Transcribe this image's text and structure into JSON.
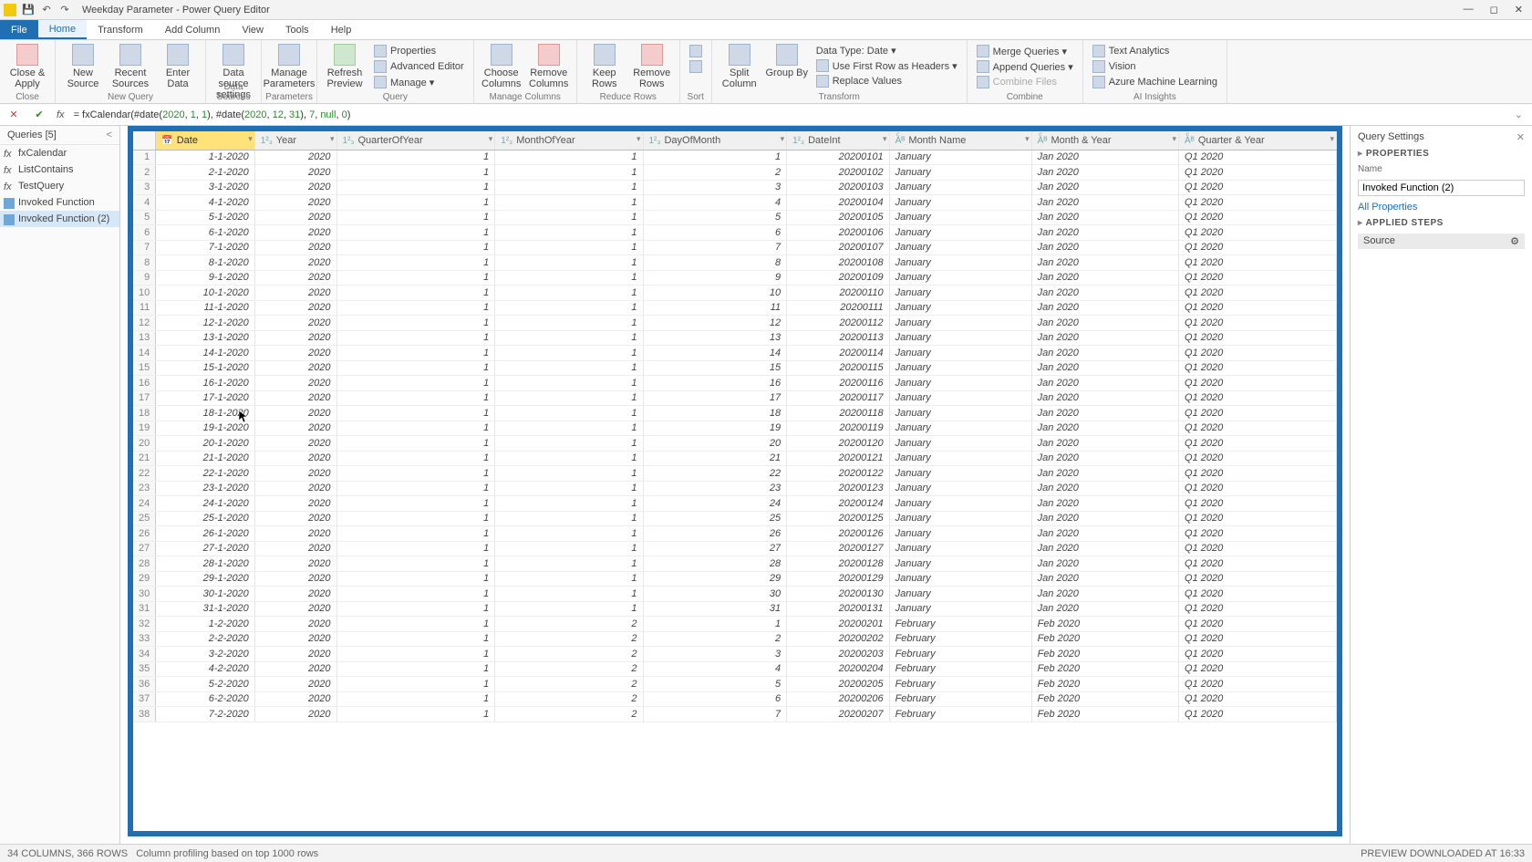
{
  "title": "Weekday Parameter - Power Query Editor",
  "tabs": [
    "File",
    "Home",
    "Transform",
    "Add Column",
    "View",
    "Tools",
    "Help"
  ],
  "activeTab": "Home",
  "ribbon": {
    "close": {
      "close_apply": "Close &\nApply",
      "group": "Close"
    },
    "newquery": {
      "new_source": "New\nSource",
      "recent": "Recent\nSources",
      "enter": "Enter\nData",
      "group": "New Query"
    },
    "datasources": {
      "ds": "Data source\nsettings",
      "group": "Data Sources"
    },
    "params": {
      "mp": "Manage\nParameters",
      "group": "Parameters"
    },
    "query": {
      "refresh": "Refresh\nPreview",
      "props": "Properties",
      "adv": "Advanced Editor",
      "manage": "Manage ▾",
      "group": "Query"
    },
    "managecols": {
      "choose": "Choose\nColumns",
      "remove": "Remove\nColumns",
      "group": "Manage Columns"
    },
    "reducerows": {
      "keep": "Keep\nRows",
      "removerows": "Remove\nRows",
      "group": "Reduce Rows"
    },
    "sort": {
      "group": "Sort"
    },
    "transform": {
      "split": "Split\nColumn",
      "group_by": "Group\nBy",
      "dtype": "Data Type: Date ▾",
      "firstrow": "Use First Row as Headers ▾",
      "replace": "Replace Values",
      "group": "Transform"
    },
    "combine": {
      "merge": "Merge Queries ▾",
      "append": "Append Queries ▾",
      "combinefiles": "Combine Files",
      "group": "Combine"
    },
    "ai": {
      "ta": "Text Analytics",
      "vision": "Vision",
      "aml": "Azure Machine Learning",
      "group": "AI Insights"
    }
  },
  "formula_prefix": "= fxCalendar(#date(",
  "formula_parts": {
    "a": "2020",
    "b": ", ",
    "c": "1",
    "d": ", ",
    "e": "1",
    "f": "), #date(",
    "g": "2020",
    "h": ", ",
    "i": "12",
    "j": ", ",
    "k": "31",
    "l": "), ",
    "m": "7",
    "n": ", ",
    "o": "null",
    "p": ", ",
    "q": "0",
    "r": ")"
  },
  "queries_hdr": "Queries [5]",
  "queries": [
    {
      "name": "fxCalendar",
      "type": "fx"
    },
    {
      "name": "ListContains",
      "type": "fx"
    },
    {
      "name": "TestQuery",
      "type": "fx"
    },
    {
      "name": "Invoked Function",
      "type": "tbl"
    },
    {
      "name": "Invoked Function (2)",
      "type": "tbl",
      "selected": true
    }
  ],
  "columns": [
    "Date",
    "Year",
    "QuarterOfYear",
    "MonthOfYear",
    "DayOfMonth",
    "DateInt",
    "Month Name",
    "Month & Year",
    "Quarter & Year"
  ],
  "col_types": [
    "📅",
    "1²₃",
    "1²₃",
    "1²₃",
    "1²₃",
    "1²₃",
    "Aͨᴮ",
    "Aͨᴮ",
    "Aͨᴮ"
  ],
  "rows": [
    [
      "1-1-2020",
      "2020",
      "1",
      "1",
      "1",
      "20200101",
      "January",
      "Jan 2020",
      "Q1 2020"
    ],
    [
      "2-1-2020",
      "2020",
      "1",
      "1",
      "2",
      "20200102",
      "January",
      "Jan 2020",
      "Q1 2020"
    ],
    [
      "3-1-2020",
      "2020",
      "1",
      "1",
      "3",
      "20200103",
      "January",
      "Jan 2020",
      "Q1 2020"
    ],
    [
      "4-1-2020",
      "2020",
      "1",
      "1",
      "4",
      "20200104",
      "January",
      "Jan 2020",
      "Q1 2020"
    ],
    [
      "5-1-2020",
      "2020",
      "1",
      "1",
      "5",
      "20200105",
      "January",
      "Jan 2020",
      "Q1 2020"
    ],
    [
      "6-1-2020",
      "2020",
      "1",
      "1",
      "6",
      "20200106",
      "January",
      "Jan 2020",
      "Q1 2020"
    ],
    [
      "7-1-2020",
      "2020",
      "1",
      "1",
      "7",
      "20200107",
      "January",
      "Jan 2020",
      "Q1 2020"
    ],
    [
      "8-1-2020",
      "2020",
      "1",
      "1",
      "8",
      "20200108",
      "January",
      "Jan 2020",
      "Q1 2020"
    ],
    [
      "9-1-2020",
      "2020",
      "1",
      "1",
      "9",
      "20200109",
      "January",
      "Jan 2020",
      "Q1 2020"
    ],
    [
      "10-1-2020",
      "2020",
      "1",
      "1",
      "10",
      "20200110",
      "January",
      "Jan 2020",
      "Q1 2020"
    ],
    [
      "11-1-2020",
      "2020",
      "1",
      "1",
      "11",
      "20200111",
      "January",
      "Jan 2020",
      "Q1 2020"
    ],
    [
      "12-1-2020",
      "2020",
      "1",
      "1",
      "12",
      "20200112",
      "January",
      "Jan 2020",
      "Q1 2020"
    ],
    [
      "13-1-2020",
      "2020",
      "1",
      "1",
      "13",
      "20200113",
      "January",
      "Jan 2020",
      "Q1 2020"
    ],
    [
      "14-1-2020",
      "2020",
      "1",
      "1",
      "14",
      "20200114",
      "January",
      "Jan 2020",
      "Q1 2020"
    ],
    [
      "15-1-2020",
      "2020",
      "1",
      "1",
      "15",
      "20200115",
      "January",
      "Jan 2020",
      "Q1 2020"
    ],
    [
      "16-1-2020",
      "2020",
      "1",
      "1",
      "16",
      "20200116",
      "January",
      "Jan 2020",
      "Q1 2020"
    ],
    [
      "17-1-2020",
      "2020",
      "1",
      "1",
      "17",
      "20200117",
      "January",
      "Jan 2020",
      "Q1 2020"
    ],
    [
      "18-1-2020",
      "2020",
      "1",
      "1",
      "18",
      "20200118",
      "January",
      "Jan 2020",
      "Q1 2020"
    ],
    [
      "19-1-2020",
      "2020",
      "1",
      "1",
      "19",
      "20200119",
      "January",
      "Jan 2020",
      "Q1 2020"
    ],
    [
      "20-1-2020",
      "2020",
      "1",
      "1",
      "20",
      "20200120",
      "January",
      "Jan 2020",
      "Q1 2020"
    ],
    [
      "21-1-2020",
      "2020",
      "1",
      "1",
      "21",
      "20200121",
      "January",
      "Jan 2020",
      "Q1 2020"
    ],
    [
      "22-1-2020",
      "2020",
      "1",
      "1",
      "22",
      "20200122",
      "January",
      "Jan 2020",
      "Q1 2020"
    ],
    [
      "23-1-2020",
      "2020",
      "1",
      "1",
      "23",
      "20200123",
      "January",
      "Jan 2020",
      "Q1 2020"
    ],
    [
      "24-1-2020",
      "2020",
      "1",
      "1",
      "24",
      "20200124",
      "January",
      "Jan 2020",
      "Q1 2020"
    ],
    [
      "25-1-2020",
      "2020",
      "1",
      "1",
      "25",
      "20200125",
      "January",
      "Jan 2020",
      "Q1 2020"
    ],
    [
      "26-1-2020",
      "2020",
      "1",
      "1",
      "26",
      "20200126",
      "January",
      "Jan 2020",
      "Q1 2020"
    ],
    [
      "27-1-2020",
      "2020",
      "1",
      "1",
      "27",
      "20200127",
      "January",
      "Jan 2020",
      "Q1 2020"
    ],
    [
      "28-1-2020",
      "2020",
      "1",
      "1",
      "28",
      "20200128",
      "January",
      "Jan 2020",
      "Q1 2020"
    ],
    [
      "29-1-2020",
      "2020",
      "1",
      "1",
      "29",
      "20200129",
      "January",
      "Jan 2020",
      "Q1 2020"
    ],
    [
      "30-1-2020",
      "2020",
      "1",
      "1",
      "30",
      "20200130",
      "January",
      "Jan 2020",
      "Q1 2020"
    ],
    [
      "31-1-2020",
      "2020",
      "1",
      "1",
      "31",
      "20200131",
      "January",
      "Jan 2020",
      "Q1 2020"
    ],
    [
      "1-2-2020",
      "2020",
      "1",
      "2",
      "1",
      "20200201",
      "February",
      "Feb 2020",
      "Q1 2020"
    ],
    [
      "2-2-2020",
      "2020",
      "1",
      "2",
      "2",
      "20200202",
      "February",
      "Feb 2020",
      "Q1 2020"
    ],
    [
      "3-2-2020",
      "2020",
      "1",
      "2",
      "3",
      "20200203",
      "February",
      "Feb 2020",
      "Q1 2020"
    ],
    [
      "4-2-2020",
      "2020",
      "1",
      "2",
      "4",
      "20200204",
      "February",
      "Feb 2020",
      "Q1 2020"
    ],
    [
      "5-2-2020",
      "2020",
      "1",
      "2",
      "5",
      "20200205",
      "February",
      "Feb 2020",
      "Q1 2020"
    ],
    [
      "6-2-2020",
      "2020",
      "1",
      "2",
      "6",
      "20200206",
      "February",
      "Feb 2020",
      "Q1 2020"
    ],
    [
      "7-2-2020",
      "2020",
      "1",
      "2",
      "7",
      "20200207",
      "February",
      "Feb 2020",
      "Q1 2020"
    ]
  ],
  "settings": {
    "title": "Query Settings",
    "properties": "PROPERTIES",
    "name_label": "Name",
    "name_value": "Invoked Function (2)",
    "all_props": "All Properties",
    "applied": "APPLIED STEPS",
    "step": "Source"
  },
  "status_left": "34 COLUMNS, 366 ROWS",
  "status_mid": "Column profiling based on top 1000 rows",
  "status_right": "PREVIEW DOWNLOADED AT 16:33"
}
